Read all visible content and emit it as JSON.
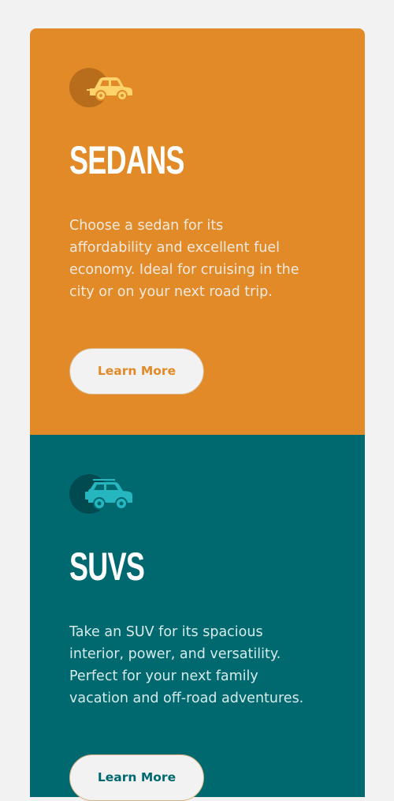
{
  "cards": [
    {
      "title": "Sedans",
      "description": "Choose a sedan for its affordability and excellent fuel economy. Ideal for cruising in the city or on your next road trip.",
      "button_label": "Learn More",
      "icon": "sedan-car-icon",
      "background_color": "#e28a27",
      "icon_color": "#ffd36b"
    },
    {
      "title": "SUVs",
      "description": "Take an SUV for its spacious interior, power, and versatility. Perfect for your next family vacation and off-road adventures.",
      "button_label": "Learn More",
      "icon": "suv-car-icon",
      "background_color": "#006970",
      "icon_color": "#26b6c0"
    }
  ]
}
